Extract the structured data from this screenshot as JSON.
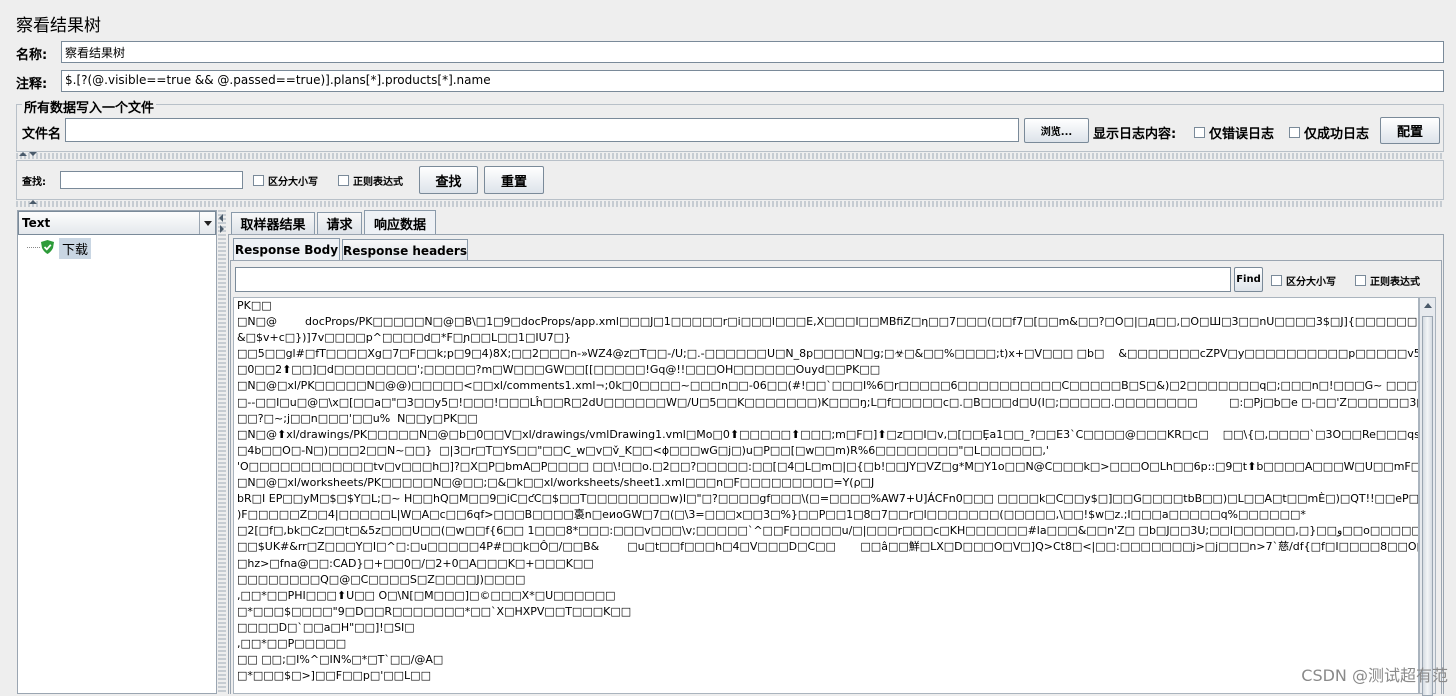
{
  "window": {
    "title": "察看结果树"
  },
  "form": {
    "name_label": "名称:",
    "name_value": "察看结果树",
    "comment_label": "注释:",
    "comment_value": "$.[?(@.visible==true && @.passed==true)].plans[*].products[*].name"
  },
  "file_group": {
    "legend": "所有数据写入一个文件",
    "filename_label": "文件名",
    "filename_value": "",
    "browse_label": "浏览...",
    "log_display_label": "显示日志内容:",
    "errors_only_label": "仅错误日志",
    "success_only_label": "仅成功日志",
    "configure_label": "配置"
  },
  "search": {
    "label": "查找:",
    "value": "",
    "case_label": "区分大小写",
    "regex_label": "正则表达式",
    "find_label": "查找",
    "reset_label": "重置"
  },
  "renderer": {
    "selected": "Text"
  },
  "tree": {
    "items": [
      {
        "label": "下载",
        "status": "success"
      }
    ]
  },
  "tabs": [
    "取样器结果",
    "请求",
    "响应数据"
  ],
  "selected_tab": "响应数据",
  "subtabs": [
    "Response Body",
    "Response headers"
  ],
  "response_search": {
    "value": "",
    "find_label": "Find",
    "case_label": "区分大小写",
    "regex_label": "正则表达式"
  },
  "response_body": [
    "PK□□",
    "□N□@        docProps/PK□□□□□N□@□B\\□1□9□docProps/app.xml□□□J□1□□□□□r□i□□□l□□□E,X□□□I□□MBfiZ□η□□7□□□(□□f7□[□□m&□□?□O□|□д□□,□O□Ш□3□□nU□□□□3$□J]{□□□□□□□□□□D□□,E8",
    "&□$v+c□})]7v□□□□p^□□□□d□*F□ɲ□□L□□1□IU7□}",
    "□□5□□gl#□fT□□□□Xg□7□F□□k;p□9□4)8X;□□2□□□n-»WZ4@z□T□□-/U;□.-□□□□□□U□N_8p□□□□N□g;□☣□&□□%□□□□;t)x+□V□□□ □b□    &□□□□□□□cZPV□y□□□□□□□□□□p□□□□□v5N/□□",
    "□0□□2⬆□□]□d□□□□□□□□';□□□□□?m□W□□□GW□□[[□□□□□!Gq@!!□□□OH□□□□□□Ouyd□□PK□□",
    "□N□@□xl/PK□□□□□N□@@)□□□□□<□□xl/comments1.xml¬;0k□0□□□□~□□□n□□-06□□(#!□□`□□□I%6□r□□□□□6□□□□□□□□□□C□□□□□B□S□&)□2□□□□□□□q□;□□□n□!□□□G~ □□□WQj□2□'□□2*P0□|□%e□□},□X",
    "□--□□I□u□@□\\x□[□□a□\"□3□□y5□!□□□!□□□Lĥ□□R□2dU□□□□□□W□/U□5□□K□□□□□□□)K□□□ŋ;L□f□□□□□c□.□B□□□d□U(I□;□□□□□.□□□□□□□□         □:□Pj□b□e □-□□'Z□□□□□□3□ □□,□□□Nc□a?O□□□P□⨆",
    "□□?□~;j□□n□□□'□□u%  N□□y□PK□□",
    "□N□@⬆xl/drawings/PK□□□□□N□@□b□0□□V□xl/drawings/vmlDrawing1.vml□Mo□0⬆□□□□□⬆□□□;m□F□]⬆□z□□I□v,□[□□Ȩa1□□_?□□E3`C□□□□@□□□KR□c□    □□\\{□,□□□□`□3O□□Re□□□qs=□d□EaR□□",
    "□4b□□O□-N□)□□□2□□N~□□}  □|3□r□T□YS□□\"□□C_w□v□v̌_K□□<ϕ□□□wG□j□)u□P□□[□w□□m)R%6□□□□□□□□\"□L□□□□□□,'",
    "'O□□□□□□□□□□□□tv□v□□□h□]?□X□P□bmA□P□□□□ □□\\!□□o.□2□□?□□□□□:□□[□4□L□m□|□{□b!□□JY□VZ□g*M□Y1o□□N@C□□□k□>□□□O□Lh□□6p::□9□t⬆b□□□□A□□□W□U□□mF□JŶ□□5□□dg□I□$□(□□□r\\□]H",
    "□N□@□xl/worksheets/PK□□□□□N□@□□;□&□k□□xl/worksheets/sheet1.xml□□□n□F□□□□□□□□□=Y(ρ□J",
    "bR□I EP□□yM□$□$Y□L;□~ H□□hQ□M□□9□iC□ƈC□$□□T□□□□□□□□w)I□\"□?□□□□gf□□□\\(□=□□□□%AW7+U]ÁCFn0□□□ □□□□k□C□□y$□]□□G□□□□tbB□□)□L□□A□t□□mÈ□)□QT!!□□eP□1□□□#",
    ")F□□□□□Z□□4|□□□□□L|W□A□c□□6qf>□□□B□□□□裛n□eиoGW□7□(□\\3=□□□x□□3□%}□□P□□1□8□7□□r□l□□□□□□□(□□□□□,\\□□!$w□z.;I□□□a□□□□□q%□□□□□□*",
    "□2[□f□,bk□Cz□□t□&5z□□□U□□(□w□□f{6□□ 1□□□8*□□□:□□□v□□□\\v;□□□□□`^□□F□□□□□u/□|□□□r□□□c□KH□□□□□□#la□□□&□□n'Z□ □b□J□□3U;□□l□□□□□□,□}□□و□□o□□□□□C□N□⬆□4*□□□!□□□□_□wl",
    "□□$UK#&rr□Z□□□Y□I□^□:□u□□□□□4P#□□k□Ô□/□□B&        □u□t□□f□□□հ□4□V□□□D□C□□       □□â□□鮮□LX□D□□□O□V□]Q>Ct8□<|□□:□□□□□□□j>□j□□□n>7`慈/df{□f□I□□□□8□□O□□□□W□□G0□□□□b[X□4□-",
    "□hz>□fna@□□:CAD}□+□□0□/□2+0□A□□□K□+□□□K□□",
    "□□□□□□□□Q□@□C□□□□S□Z□□□□J)□□□□",
    ",□□*□□PHI□□□⬆U□□ O□\\N[□M□□□]□©□□□X*□U□□□□□□",
    "□*□□□$□□□□\"9□D□□R□□□□□□□*□□`X□HXPV□□T□□□K□□",
    "□□□□D□`□□a□H\"□□]!□SI□",
    ",□□*□□P□□□□□",
    "□□ □□;□I%^□IN%□*□T`□□/@A□",
    "□*□□□$□>]□□F□□p□'□□L□□"
  ],
  "watermark": "CSDN @测试超有范"
}
